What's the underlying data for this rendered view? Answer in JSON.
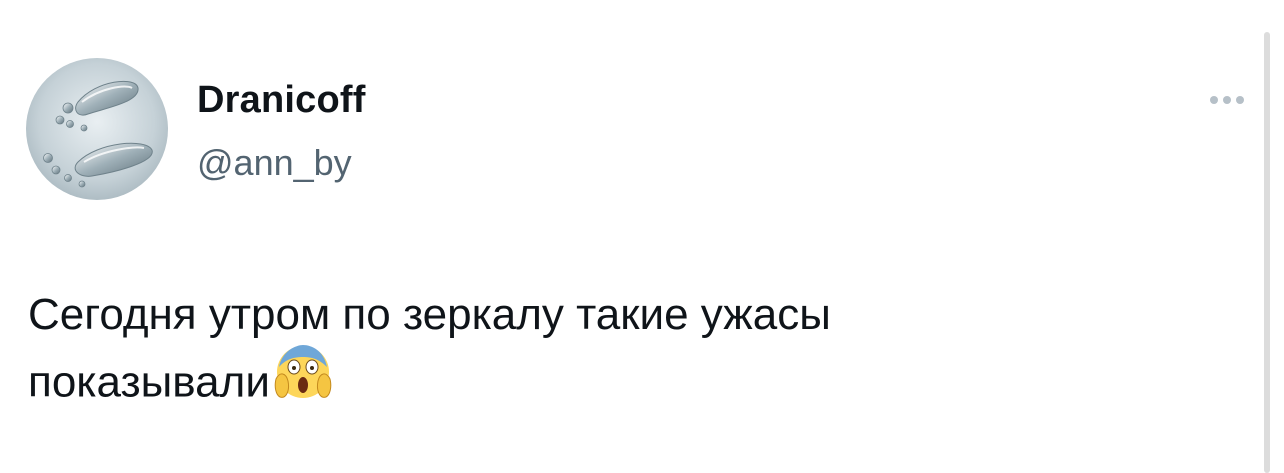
{
  "tweet": {
    "author": {
      "display_name": "Dranicoff",
      "handle": "@ann_by",
      "avatar_icon": "water-drops-avatar"
    },
    "more_icon": "more-horizontal-icon",
    "text_lines": [
      "Сегодня утром по зеркалу такие ужасы",
      "показывали"
    ],
    "emoji_icon": "face-screaming-in-fear-emoji"
  },
  "colors": {
    "name": "#0f1419",
    "handle": "#536471",
    "more_dots": "#b6c0c8",
    "scrollbar": "#dcdcdc"
  }
}
